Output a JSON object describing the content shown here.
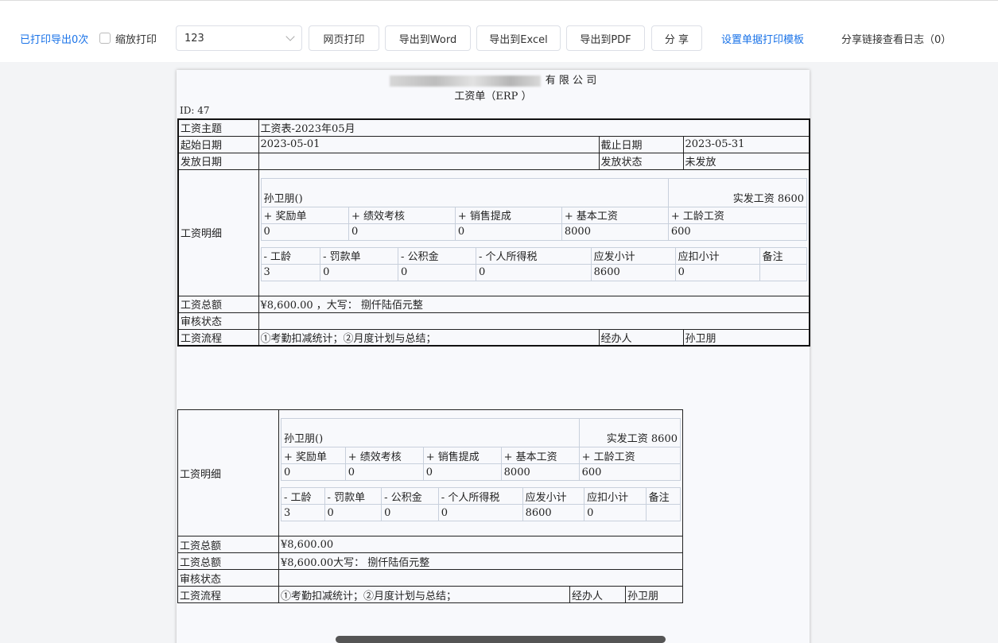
{
  "toolbar": {
    "print_count": "已打印导出0次",
    "scale_print": "缩放打印",
    "select_value": "123",
    "btn_web_print": "网页打印",
    "btn_word": "导出到Word",
    "btn_excel": "导出到Excel",
    "btn_pdf": "导出到PDF",
    "btn_share": "分 享",
    "template_link": "设置单据打印模板",
    "share_log": "分享链接查看日志（0）"
  },
  "doc": {
    "company_suffix": "有 限 公 司",
    "title": "工资单（ERP        ）",
    "id_line": "ID:    47",
    "labels": {
      "subject": "工资主题",
      "start": "起始日期",
      "end": "截止日期",
      "pay_date": "发放日期",
      "pay_status": "发放状态",
      "detail": "工资明细",
      "total": "工资总额",
      "audit": "审核状态",
      "flow": "工资流程",
      "handler": "经办人"
    },
    "values": {
      "subject": "工资表-2023年05月",
      "start": "2023-05-01",
      "end": "2023-05-31",
      "pay_date": "",
      "pay_status": "未发放",
      "total": "¥8,600.00  ，大写：   捌仟陆佰元整",
      "audit": "",
      "flow": "①考勤扣减统计；②月度计划与总结；",
      "handler": "孙卫朋"
    },
    "detail": {
      "person": "孙卫朋()",
      "actual_pay": "实发工资 8600",
      "plus_headers": [
        "+ 奖励单",
        "+ 绩效考核",
        "+ 销售提成",
        "+ 基本工资",
        "+ 工龄工资"
      ],
      "plus_values": [
        "0",
        "0",
        "0",
        "8000",
        "600"
      ],
      "minus_headers": [
        "- 工龄",
        "- 罚款单",
        "- 公积金",
        "- 个人所得税",
        "应发小计",
        "应扣小计",
        "备注"
      ],
      "minus_values": [
        "3",
        "0",
        "0",
        "0",
        "8600",
        "0",
        ""
      ]
    },
    "second": {
      "total_plain": "¥8,600.00",
      "total_words": "¥8,600.00大写：    捌仟陆佰元整"
    }
  }
}
